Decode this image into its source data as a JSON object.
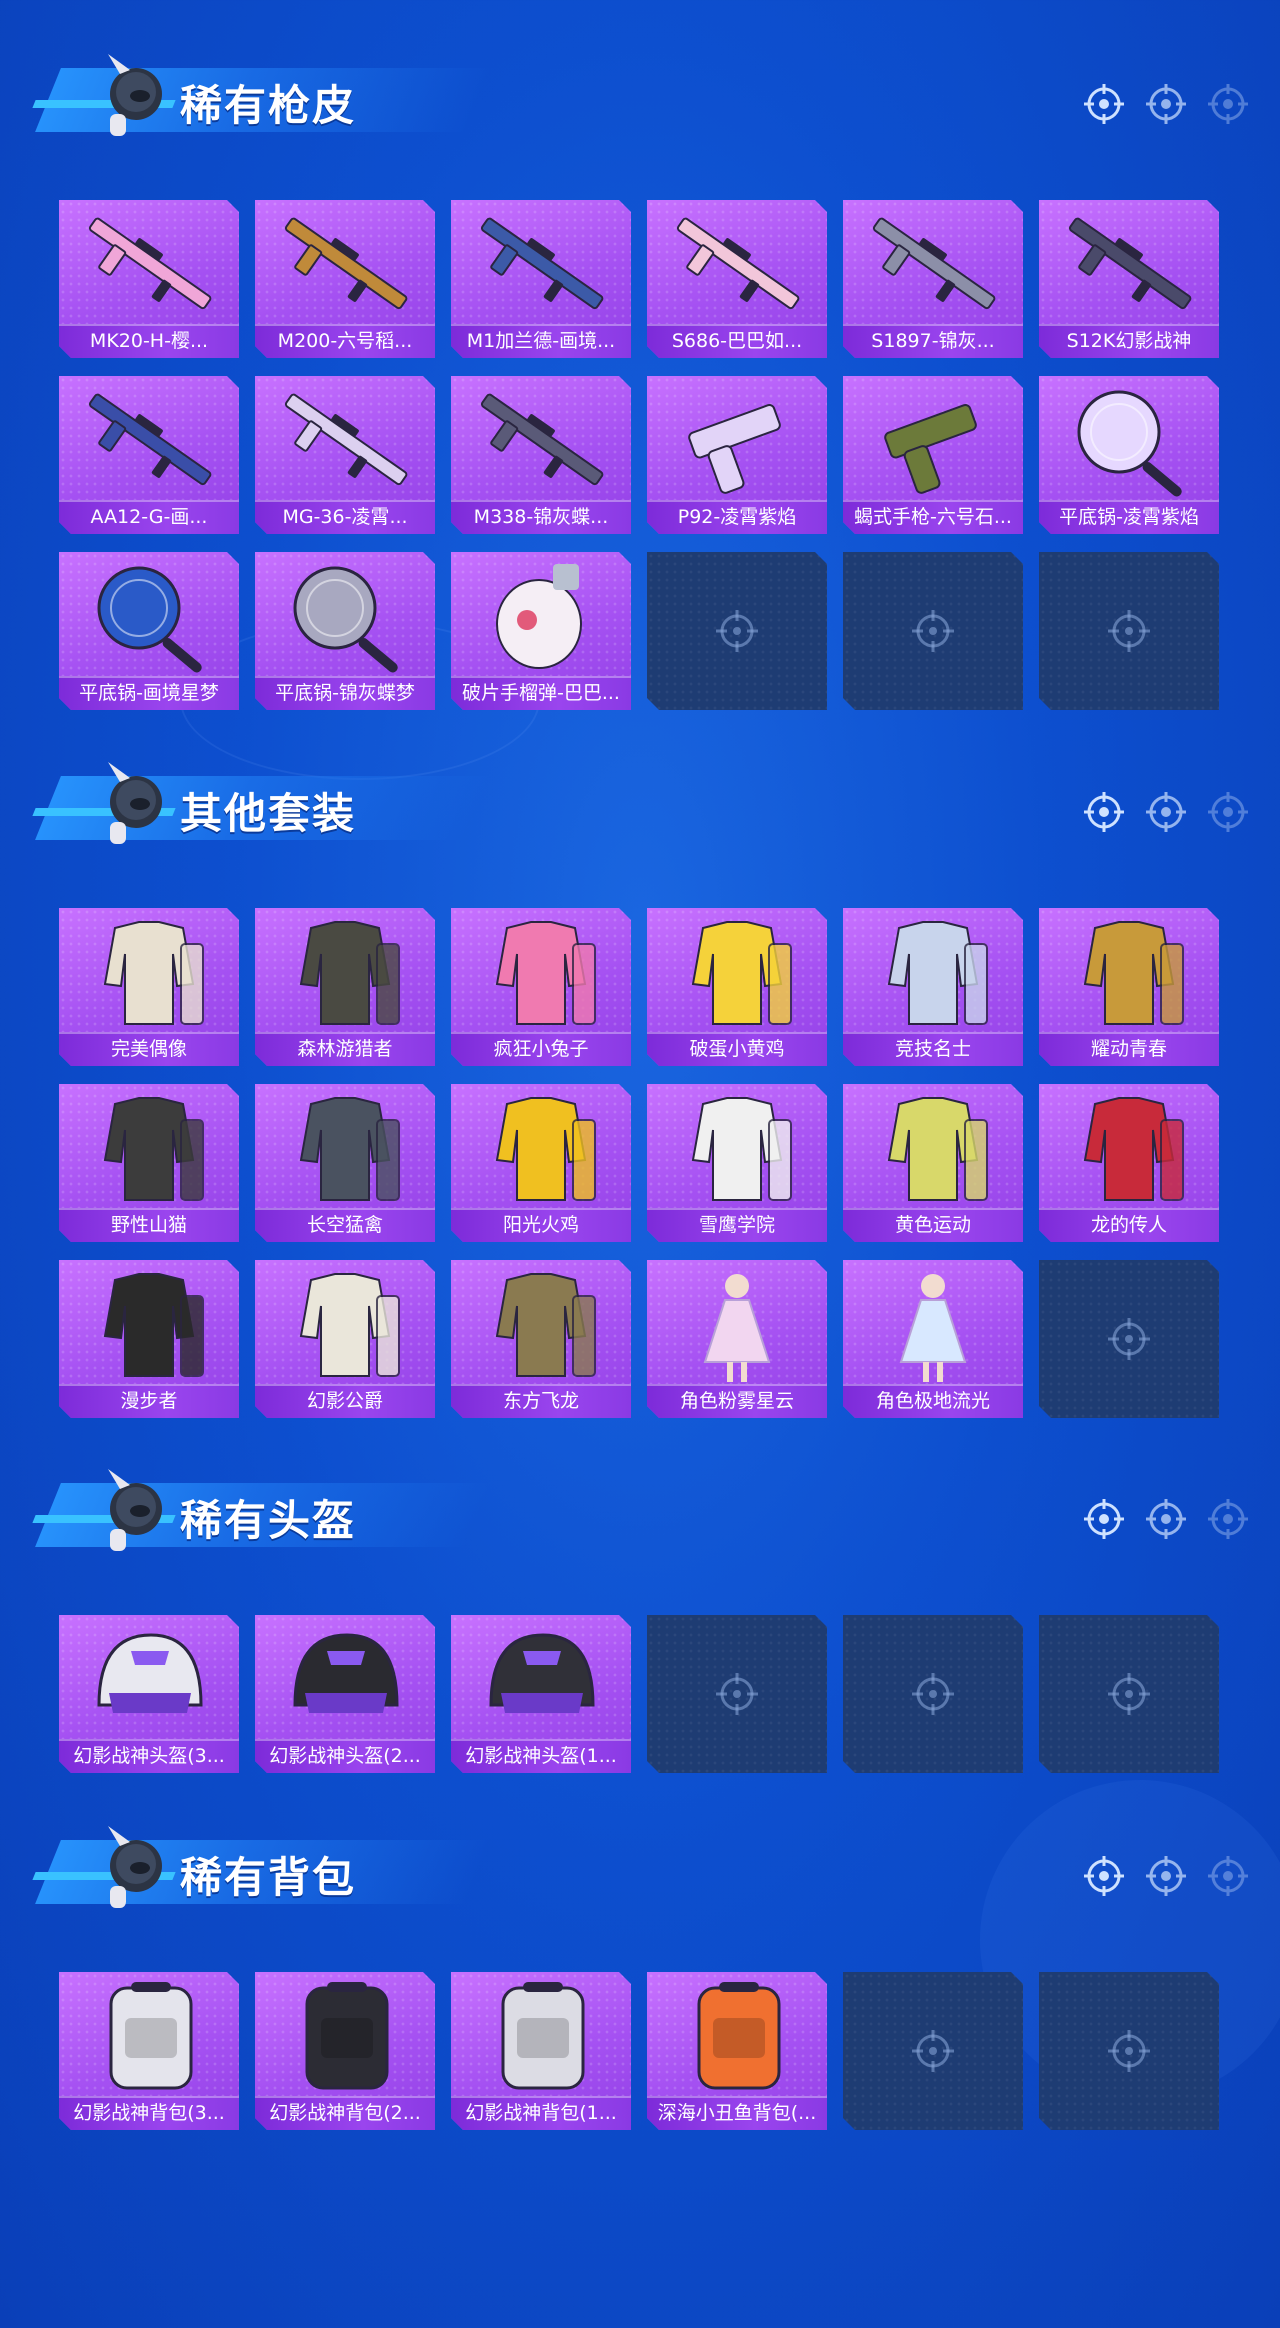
{
  "theme": {
    "background": "#0d4fcf",
    "card_purple": "#a551f2",
    "label_purple": "#7d2bd9",
    "empty_card": "#1e3c73",
    "banner_blue": "#2896ff"
  },
  "sections": [
    {
      "title": "稀有枪皮",
      "items": [
        {
          "label": "MK20-H-樱...",
          "icon": "rifle-icon",
          "color": "#f0a6d8"
        },
        {
          "label": "M200-六号稻...",
          "icon": "sniper-rifle-icon",
          "color": "#c08a3a"
        },
        {
          "label": "M1加兰德-画境...",
          "icon": "rifle-icon",
          "color": "#3c5aa8"
        },
        {
          "label": "S686-巴巴如...",
          "icon": "shotgun-icon",
          "color": "#f2c6da"
        },
        {
          "label": "S1897-锦灰...",
          "icon": "shotgun-icon",
          "color": "#8c8fa8"
        },
        {
          "label": "S12K幻影战神",
          "icon": "shotgun-icon",
          "color": "#4a4a6a"
        },
        {
          "label": "AA12-G-画...",
          "icon": "smg-icon",
          "color": "#3a4ea8"
        },
        {
          "label": "MG-36-凌霄...",
          "icon": "machine-gun-icon",
          "color": "#dcd0f0"
        },
        {
          "label": "M338-锦灰蝶...",
          "icon": "rifle-icon",
          "color": "#5a5a78"
        },
        {
          "label": "P92-凌霄紫焰",
          "icon": "pistol-icon",
          "color": "#e2d4f8"
        },
        {
          "label": "蝎式手枪-六号石...",
          "icon": "pistol-icon",
          "color": "#6c7a3a"
        },
        {
          "label": "平底锅-凌霄紫焰",
          "icon": "frying-pan-icon",
          "color": "#e6d8ff"
        },
        {
          "label": "平底锅-画境星梦",
          "icon": "frying-pan-icon",
          "color": "#2a5ac8"
        },
        {
          "label": "平底锅-锦灰蝶梦",
          "icon": "frying-pan-icon",
          "color": "#a8a8c0"
        },
        {
          "label": "破片手榴弹-巴巴...",
          "icon": "grenade-icon",
          "color": "#f5eef5"
        }
      ],
      "empty_slots": 3
    },
    {
      "title": "其他套装",
      "items": [
        {
          "label": "完美偶像",
          "icon": "outfit-icon",
          "color": "#e8e0d0"
        },
        {
          "label": "森林游猎者",
          "icon": "outfit-icon",
          "color": "#4a4a42"
        },
        {
          "label": "疯狂小兔子",
          "icon": "outfit-icon",
          "color": "#f07ab0"
        },
        {
          "label": "破蛋小黄鸡",
          "icon": "outfit-icon",
          "color": "#f5d23a"
        },
        {
          "label": "竞技名士",
          "icon": "outfit-icon",
          "color": "#c8d4ec"
        },
        {
          "label": "耀动青春",
          "icon": "outfit-icon",
          "color": "#c89a3a"
        },
        {
          "label": "野性山猫",
          "icon": "outfit-icon",
          "color": "#3c3c3c"
        },
        {
          "label": "长空猛禽",
          "icon": "outfit-icon",
          "color": "#4a5260"
        },
        {
          "label": "阳光火鸡",
          "icon": "outfit-icon",
          "color": "#f0c020"
        },
        {
          "label": "雪鹰学院",
          "icon": "outfit-icon",
          "color": "#f0f0f0"
        },
        {
          "label": "黄色运动",
          "icon": "outfit-icon",
          "color": "#d8d86a"
        },
        {
          "label": "龙的传人",
          "icon": "outfit-icon",
          "color": "#c82a3a"
        },
        {
          "label": "漫步者",
          "icon": "outfit-icon",
          "color": "#2a2a2a"
        },
        {
          "label": "幻影公爵",
          "icon": "outfit-icon",
          "color": "#eae6da"
        },
        {
          "label": "东方飞龙",
          "icon": "outfit-icon",
          "color": "#8a7a50"
        },
        {
          "label": "角色粉雾星云",
          "icon": "character-icon",
          "color": "#f2d6f0"
        },
        {
          "label": "角色极地流光",
          "icon": "character-icon",
          "color": "#d8e8ff"
        }
      ],
      "empty_slots": 1
    },
    {
      "title": "稀有头盔",
      "items": [
        {
          "label": "幻影战神头盔(3...",
          "icon": "helmet-icon",
          "color": "#e8e8f0"
        },
        {
          "label": "幻影战神头盔(2...",
          "icon": "helmet-icon",
          "color": "#2a2a30"
        },
        {
          "label": "幻影战神头盔(1...",
          "icon": "helmet-icon",
          "color": "#303038"
        }
      ],
      "empty_slots": 3
    },
    {
      "title": "稀有背包",
      "items": [
        {
          "label": "幻影战神背包(3...",
          "icon": "backpack-icon",
          "color": "#e4e4ec"
        },
        {
          "label": "幻影战神背包(2...",
          "icon": "backpack-icon",
          "color": "#2c2c34"
        },
        {
          "label": "幻影战神背包(1...",
          "icon": "backpack-icon",
          "color": "#dcdce4"
        },
        {
          "label": "深海小丑鱼背包(...",
          "icon": "backpack-icon",
          "color": "#f07030"
        }
      ],
      "empty_slots": 2
    }
  ]
}
